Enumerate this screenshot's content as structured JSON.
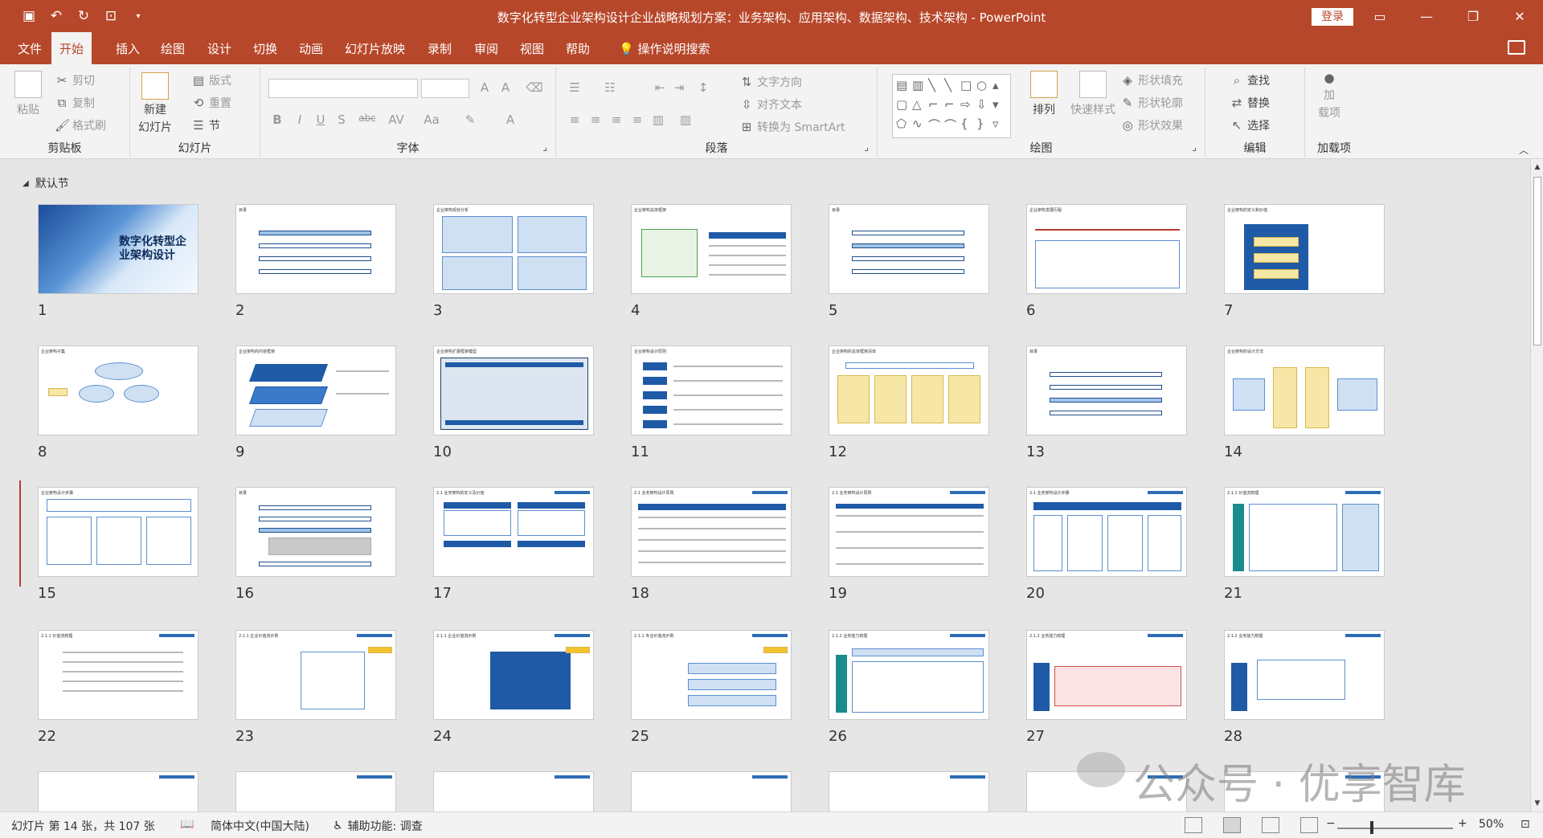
{
  "titlebar": {
    "title": "数字化转型企业架构设计企业战略规划方案：业务架构、应用架构、数据架构、技术架构  -  PowerPoint",
    "login": "登录",
    "qat_icons": [
      "save-icon",
      "undo-icon",
      "redo-icon",
      "present-icon",
      "customize-icon"
    ],
    "window_controls": [
      "restore-ribbon-icon",
      "minimize-icon",
      "maximize-icon",
      "close-icon"
    ]
  },
  "tabs": [
    "文件",
    "开始",
    "插入",
    "绘图",
    "设计",
    "切换",
    "动画",
    "幻灯片放映",
    "录制",
    "审阅",
    "视图",
    "帮助"
  ],
  "active_tab": "开始",
  "search": {
    "label": "操作说明搜索"
  },
  "ribbon": {
    "clipboard": {
      "label": "剪贴板",
      "paste": "粘贴",
      "cut": "剪切",
      "copy": "复制",
      "format_painter": "格式刷"
    },
    "slides": {
      "label": "幻灯片",
      "new_slide_1": "新建",
      "new_slide_2": "幻灯片",
      "layout": "版式",
      "reset": "重置",
      "section": "节"
    },
    "font": {
      "label": "字体",
      "buttons": [
        "B",
        "I",
        "U",
        "S",
        "abc",
        "AV",
        "Aa",
        "A"
      ]
    },
    "paragraph": {
      "label": "段落",
      "text_direction": "文字方向",
      "align_text": "对齐文本",
      "smartart": "转换为 SmartArt"
    },
    "drawing": {
      "label": "绘图",
      "arrange": "排列",
      "quick_styles": "快速样式",
      "shape_fill": "形状填充",
      "shape_outline": "形状轮廓",
      "shape_effects": "形状效果"
    },
    "editing": {
      "label": "编辑",
      "find": "查找",
      "replace": "替换",
      "select": "选择"
    },
    "addins": {
      "label": "加载项",
      "addin_1": "加",
      "addin_2": "载项"
    }
  },
  "section": {
    "name": "默认节"
  },
  "cover": {
    "title": "数字化转型企业架构设计"
  },
  "slides": [
    "1",
    "2",
    "3",
    "4",
    "5",
    "6",
    "7",
    "8",
    "9",
    "10",
    "11",
    "12",
    "13",
    "14",
    "15",
    "16",
    "17",
    "18",
    "19",
    "20",
    "21",
    "22",
    "23",
    "24",
    "25",
    "26",
    "27",
    "28"
  ],
  "slide_headers": {
    "toc": "目录",
    "s3": "企业架构现状分析",
    "s4": "企业架构总体框架",
    "s6": "企业架构发展历程",
    "s7": "企业架构的定义和价值",
    "s8": "企业架构子集",
    "s9": "企业架构的内容框架",
    "s10": "企业架构扩展框架模型",
    "s11": "企业架构设计原则",
    "s12": "企业架构的总体框架清单",
    "s14": "企业架构的设计方法",
    "s15": "企业架构设计步骤",
    "s17": "2.1 业务架构的定义及价值",
    "s18": "2.1 业务架构设计原则",
    "s19": "2.1 业务架构设计原则",
    "s20": "2.1 业务架构设计步骤",
    "s21": "2.1.1 价值流梳理",
    "s22": "2.1.1 价值流梳理",
    "s23": "2.1.1 企业价值流示例",
    "s24": "2.1.1 企业价值流示例",
    "s25": "2.1.1 专业价值流示例",
    "s26": "2.1.2 业务能力梳理",
    "s27": "2.1.2 业务能力梳理",
    "s28": "2.1.2 业务能力梳理"
  },
  "toc_items": [
    "企业架构现状分析",
    "企业架构内容框架",
    "企业架构设计方法",
    "附件"
  ],
  "toc_nums": [
    "01",
    "02",
    "03",
    "04"
  ],
  "watermark": "公众号 · 优享智库",
  "statusbar": {
    "slide_info": "幻灯片 第 14 张，共 107 张",
    "language": "简体中文(中国大陆)",
    "accessibility": "辅助功能: 调查",
    "zoom": "50%"
  }
}
